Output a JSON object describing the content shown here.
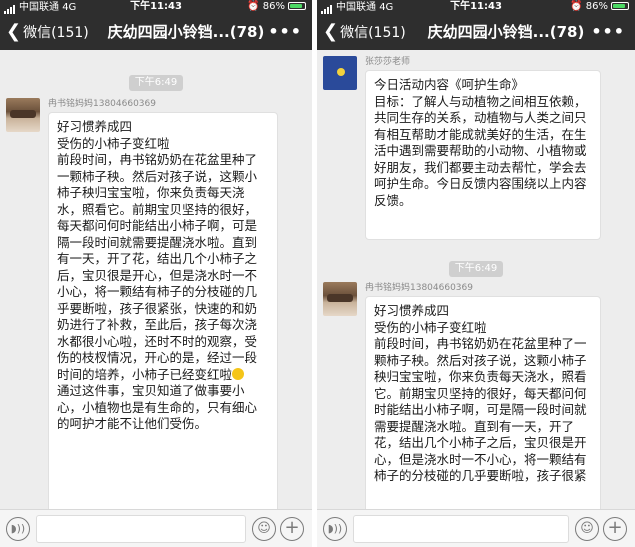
{
  "status": {
    "carrier": "中国联通",
    "network": "4G",
    "time": "下午11:43",
    "battery": "86%",
    "battery_level": 0.86
  },
  "nav": {
    "back_label": "微信(151)",
    "title": "庆幼四园小铃铛...(78)",
    "more": "•••"
  },
  "left": {
    "timestamp": "下午6:49",
    "msg": {
      "sender": "冉书铭妈妈13804660369",
      "lines": [
        "好习惯养成四",
        "受伤的小柿子变红啦",
        "前段时间，冉书铭奶奶在花盆里种了一颗柿子秧。然后对孩子说，这颗小柿子秧归宝宝啦，你来负责每天浇水，照看它。前期宝贝坚持的很好，每天都问何时能结出小柿子啊，可是隔一段时间就需要提醒浇水啦。直到有一天，开了花，结出几个小柿子之后，宝贝很是开心，但是浇水时一不小心，将一颗结有柿子的分枝碰的几乎要断啦，孩子很紧张，快速的和奶奶进行了补救，至此后，孩子每次浇水都很小心啦，还时不时的观察，受伤的枝杈情况，开心的是，经过一段时间的培养，小柿子已经变红啦",
        "通过这件事，宝贝知道了做事要小心，小植物也是有生命的，只有细心的呵护才能不让他们受伤。"
      ]
    }
  },
  "right": {
    "msg1": {
      "sender": "张莎莎老师",
      "lines": [
        "今日活动内容《呵护生命》",
        "目标：了解人与动植物之间相互依赖，共同生存的关系，动植物与人类之间只有相互帮助才能成就美好的生活，在生活中遇到需要帮助的小动物、小植物或好朋友，我们都要主动去帮忙，学会去呵护生命。今日反馈内容围绕以上内容反馈。"
      ]
    },
    "timestamp": "下午6:49",
    "msg2": {
      "sender": "冉书铭妈妈13804660369",
      "lines": [
        "好习惯养成四",
        "受伤的小柿子变红啦",
        "前段时间，冉书铭奶奶在花盆里种了一颗柿子秧。然后对孩子说，这颗小柿子秧归宝宝啦，你来负责每天浇水，照看它。前期宝贝坚持的很好，每天都问何时能结出小柿子啊，可是隔一段时间就需要提醒浇水啦。直到有一天，开了花，结出几个小柿子之后，宝贝很是开心，但是浇水时一不小心，将一颗结有柿子的分枝碰的几乎要断啦，孩子很紧"
      ]
    }
  },
  "colors": {
    "nav_bg": "#2e2e2e",
    "chat_bg": "#ededed",
    "bubble_bg": "#ffffff",
    "battery": "#4cd964"
  },
  "icons": {
    "voice": "voice-icon",
    "emoji": "emoji-icon",
    "plus": "plus-icon",
    "back": "chevron-left-icon",
    "more": "more-icon"
  }
}
